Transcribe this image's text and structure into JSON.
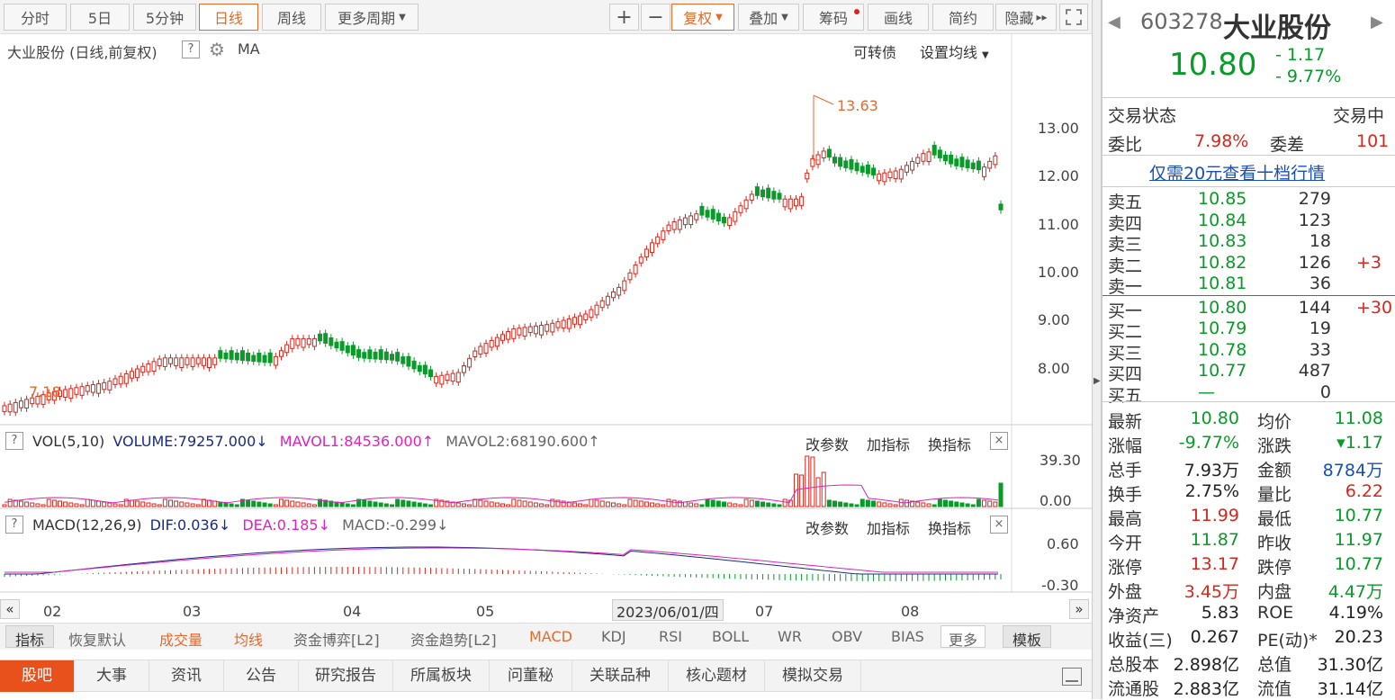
{
  "toolbar": {
    "fenshi": "分时",
    "day5": "5日",
    "min5": "5分钟",
    "daily": "日线",
    "weekly": "周线",
    "more_periods": "更多周期",
    "plus": "+",
    "minus": "−",
    "fuquan": "复权",
    "diejia": "叠加",
    "chouma": "筹码",
    "draw": "画线",
    "jianyue": "简约",
    "hide": "隐藏",
    "hide_arrows": "▸▸",
    "fullscreen_icon": "expand-icon"
  },
  "main_chart": {
    "title": "大业股份 (日线,前复权)",
    "help": "?",
    "ma_label": "MA",
    "convertible": "可转债",
    "set_ma": "设置均线",
    "high_annotation": "13.63",
    "low_annotation": "7.18",
    "price_ticks": [
      "13.00",
      "12.00",
      "11.00",
      "10.00",
      "9.00",
      "8.00"
    ]
  },
  "vol_panel": {
    "help": "?",
    "name": "VOL(5,10)",
    "volume": "VOLUME:79257.000",
    "volume_arrow": "↓",
    "mavol1": "MAVOL1:84536.000",
    "mavol1_arrow": "↑",
    "mavol2": "MAVOL2:68190.600",
    "mavol2_arrow": "↑",
    "edit": "改参数",
    "add": "加指标",
    "switch": "换指标",
    "close": "×",
    "ticks": [
      "39.30",
      "0.00"
    ]
  },
  "macd_panel": {
    "help": "?",
    "name": "MACD(12,26,9)",
    "dif": "DIF:0.036",
    "dif_arrow": "↓",
    "dea": "DEA:0.185",
    "dea_arrow": "↓",
    "macd": "MACD:-0.299",
    "macd_arrow": "↓",
    "edit": "改参数",
    "add": "加指标",
    "switch": "换指标",
    "close": "×",
    "ticks": [
      "0.60",
      "-0.30"
    ]
  },
  "time_axis": {
    "labels": [
      "02",
      "03",
      "04",
      "05",
      "07",
      "08"
    ],
    "cursor_date": "2023/06/01/四",
    "scroll_left": "«",
    "scroll_right": "»"
  },
  "indicator_tabs": [
    "指标",
    "恢复默认",
    "成交量",
    "均线",
    "资金博弈[L2]",
    "资金趋势[L2]",
    "MACD",
    "KDJ",
    "RSI",
    "BOLL",
    "WR",
    "OBV",
    "BIAS",
    "更多",
    "模板"
  ],
  "bottom_tabs": [
    "股吧",
    "大事",
    "资讯",
    "公告",
    "研究报告",
    "所属板块",
    "问董秘",
    "关联品种",
    "核心题材",
    "模拟交易"
  ],
  "quote": {
    "code": "603278",
    "name": "大业股份",
    "price": "10.80",
    "change": "- 1.17",
    "change_pct": "- 9.77%",
    "status_label": "交易状态",
    "status": "交易中",
    "weibi_label": "委比",
    "weibi": "7.98%",
    "weicha_label": "委差",
    "weicha": "101",
    "depth_link": "仅需20元查看十档行情",
    "asks": [
      {
        "label": "卖五",
        "price": "10.85",
        "vol": "279",
        "delta": ""
      },
      {
        "label": "卖四",
        "price": "10.84",
        "vol": "123",
        "delta": ""
      },
      {
        "label": "卖三",
        "price": "10.83",
        "vol": "18",
        "delta": ""
      },
      {
        "label": "卖二",
        "price": "10.82",
        "vol": "126",
        "delta": "+3"
      },
      {
        "label": "卖一",
        "price": "10.81",
        "vol": "36",
        "delta": ""
      }
    ],
    "bids": [
      {
        "label": "买一",
        "price": "10.80",
        "vol": "144",
        "delta": "+30"
      },
      {
        "label": "买二",
        "price": "10.79",
        "vol": "19",
        "delta": ""
      },
      {
        "label": "买三",
        "price": "10.78",
        "vol": "33",
        "delta": ""
      },
      {
        "label": "买四",
        "price": "10.77",
        "vol": "487",
        "delta": ""
      },
      {
        "label": "买五",
        "price": "—",
        "vol": "0",
        "delta": ""
      }
    ],
    "stats": [
      {
        "l1": "最新",
        "v1": "10.80",
        "l2": "均价",
        "v2": "11.08"
      },
      {
        "l1": "涨幅",
        "v1": "-9.77%",
        "l2": "涨跌",
        "v2": "▾1.17"
      },
      {
        "l1": "总手",
        "v1": "7.93万",
        "l2": "金额",
        "v2": "8784万"
      },
      {
        "l1": "换手",
        "v1": "2.75%",
        "l2": "量比",
        "v2": "6.22"
      },
      {
        "l1": "最高",
        "v1": "11.99",
        "l2": "最低",
        "v2": "10.77"
      },
      {
        "l1": "今开",
        "v1": "11.87",
        "l2": "昨收",
        "v2": "11.97"
      },
      {
        "l1": "涨停",
        "v1": "13.17",
        "l2": "跌停",
        "v2": "10.77"
      },
      {
        "l1": "外盘",
        "v1": "3.45万",
        "l2": "内盘",
        "v2": "4.47万"
      },
      {
        "l1": "净资产",
        "v1": "5.83",
        "l2": "ROE",
        "v2": "4.19%"
      },
      {
        "l1": "收益(三)",
        "v1": "0.267",
        "l2": "PE(动)*",
        "v2": "20.23"
      },
      {
        "l1": "总股本",
        "v1": "2.898亿",
        "l2": "总值",
        "v2": "31.30亿"
      },
      {
        "l1": "流通股",
        "v1": "2.883亿",
        "l2": "流值",
        "v2": "31.14亿"
      }
    ]
  },
  "colors": {
    "up": "#d6271c",
    "down": "#0a9a2a",
    "accent": "#e36b2c",
    "link": "#1a4fb5"
  }
}
